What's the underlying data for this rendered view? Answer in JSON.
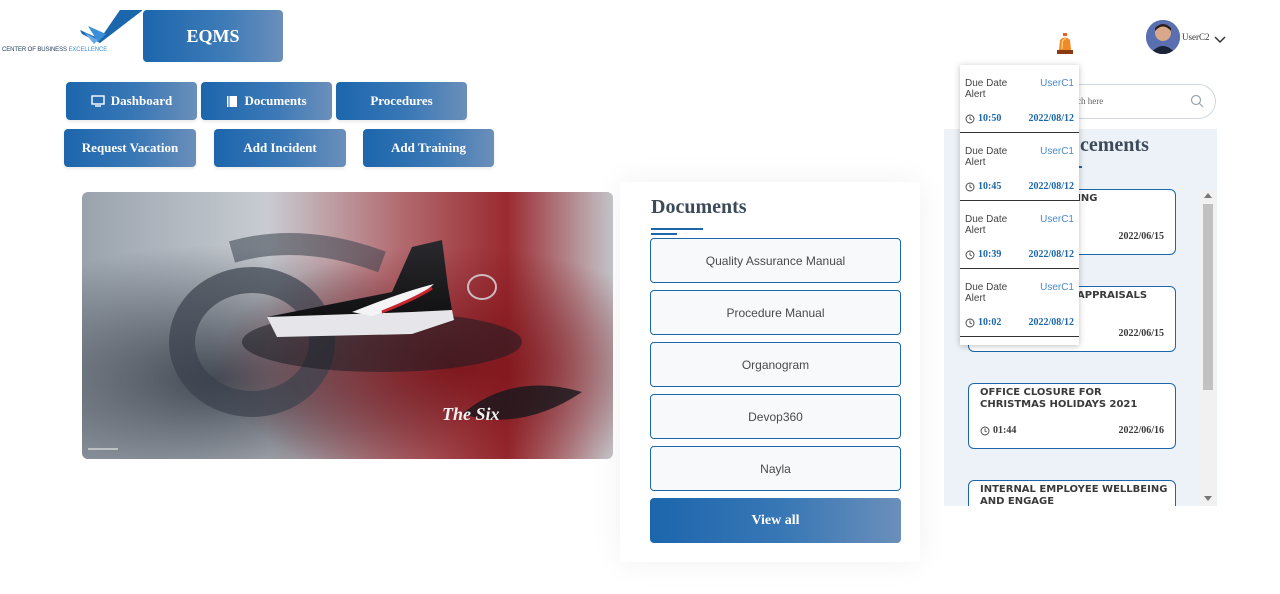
{
  "logo": {
    "text_main": "CENTER OF BUSINESS ",
    "text_accent": "EXCELLENCE"
  },
  "brand": {
    "label": "EQMS"
  },
  "nav": {
    "dashboard": "Dashboard",
    "documents": "Documents",
    "procedures": "Procedures",
    "request_vacation": "Request Vacation",
    "add_incident": "Add Incident",
    "add_training": "Add Training"
  },
  "hero": {
    "caption": "The Six"
  },
  "documents": {
    "title": "Documents",
    "items": [
      "Quality Assurance Manual",
      "Procedure Manual",
      "Organogram",
      "Devop360",
      "Nayla"
    ],
    "view_all": "View all"
  },
  "header": {
    "username": "UserC2"
  },
  "search": {
    "placeholder": "rch here"
  },
  "announcements": {
    "title_visible": "cements",
    "items": [
      {
        "title": "EE WELLBEING",
        "time": "",
        "date": "2022/06/15"
      },
      {
        "title": "APPRAISALS",
        "time": "",
        "date": "2022/06/15"
      },
      {
        "title": "OFFICE CLOSURE FOR CHRISTMAS HOLIDAYS 2021",
        "time": "01:44",
        "date": "2022/06/16"
      },
      {
        "title": "INTERNAL EMPLOYEE WELLBEING AND ENGAGE",
        "time": "",
        "date": ""
      }
    ]
  },
  "notifications": [
    {
      "type": "Due Date Alert",
      "user": "UserC1",
      "time": "10:50",
      "date": "2022/08/12"
    },
    {
      "type": "Due Date Alert",
      "user": "UserC1",
      "time": "10:45",
      "date": "2022/08/12"
    },
    {
      "type": "Due Date Alert",
      "user": "UserC1",
      "time": "10:39",
      "date": "2022/08/12"
    },
    {
      "type": "Due Date Alert",
      "user": "UserC1",
      "time": "10:02",
      "date": "2022/08/12"
    }
  ],
  "colors": {
    "primary": "#1c66ac",
    "accent": "#3a8fd8",
    "alert_bell": "#e8601c",
    "panel_bg": "#ecf2f7"
  }
}
